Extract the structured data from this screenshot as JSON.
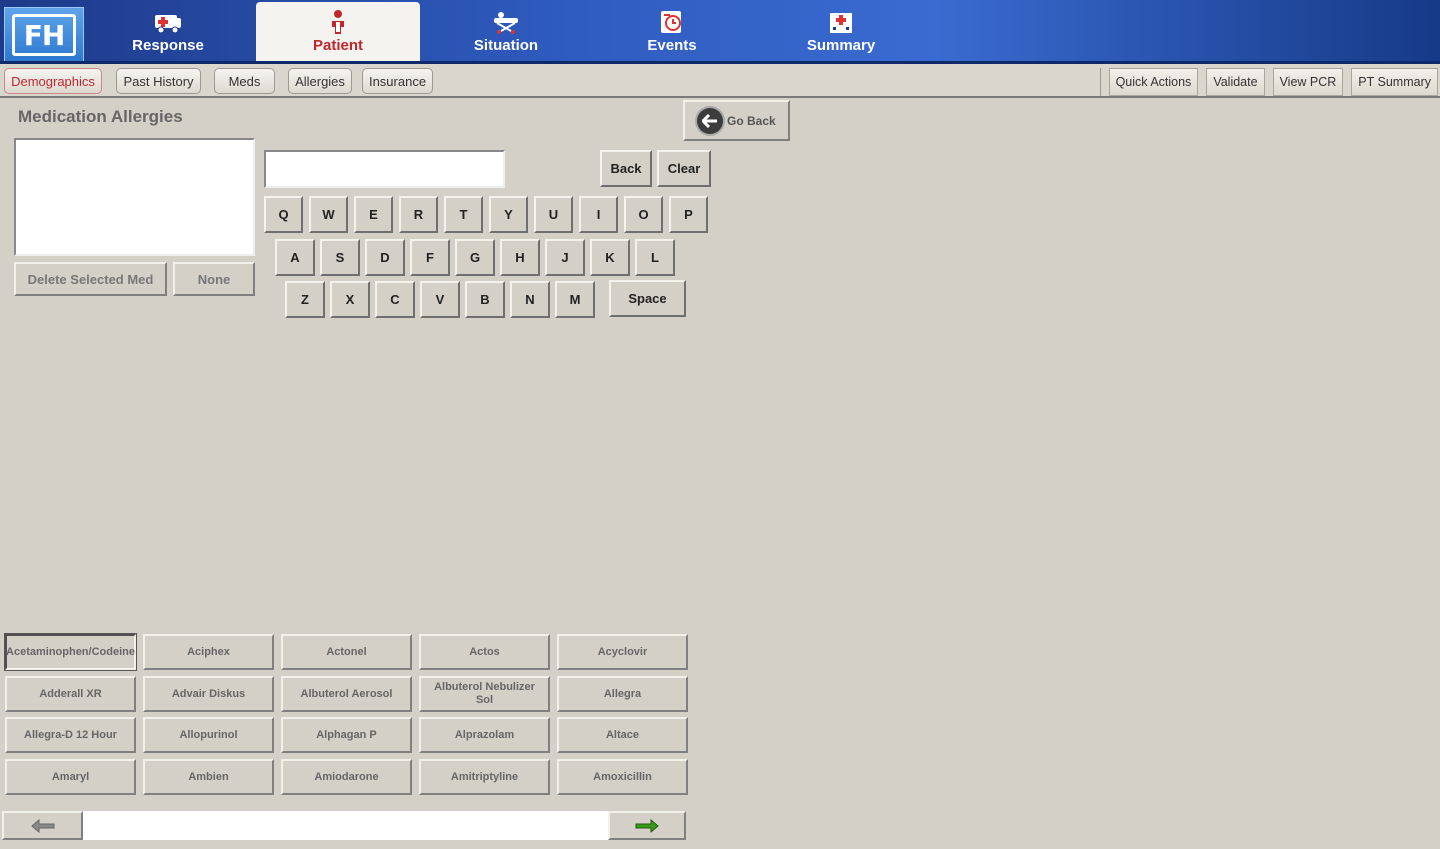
{
  "app": {
    "logo_text": "FH"
  },
  "main_tabs": [
    {
      "label": "Response",
      "icon": "ambulance-icon"
    },
    {
      "label": "Patient",
      "icon": "patient-icon",
      "active": true
    },
    {
      "label": "Situation",
      "icon": "stretcher-icon"
    },
    {
      "label": "Events",
      "icon": "clock-clipboard-icon"
    },
    {
      "label": "Summary",
      "icon": "hospital-icon"
    }
  ],
  "sub_tabs": [
    {
      "label": "Demographics",
      "active": true
    },
    {
      "label": "Past History"
    },
    {
      "label": "Meds"
    },
    {
      "label": "Allergies"
    },
    {
      "label": "Insurance"
    }
  ],
  "actions": [
    "Quick Actions",
    "Validate",
    "View PCR",
    "PT Summary"
  ],
  "section": {
    "title": "Medication Allergies",
    "delete_label": "Delete Selected Med",
    "none_label": "None",
    "go_back_label": "Go Back"
  },
  "search": {
    "value": ""
  },
  "keyboard": {
    "back_label": "Back",
    "clear_label": "Clear",
    "space_label": "Space",
    "row1": [
      "Q",
      "W",
      "E",
      "R",
      "T",
      "Y",
      "U",
      "I",
      "O",
      "P"
    ],
    "row2": [
      "A",
      "S",
      "D",
      "F",
      "G",
      "H",
      "J",
      "K",
      "L"
    ],
    "row3": [
      "Z",
      "X",
      "C",
      "V",
      "B",
      "N",
      "M"
    ]
  },
  "meds": [
    "Acetaminophen/Codeine",
    "Aciphex",
    "Actonel",
    "Actos",
    "Acyclovir",
    "Adderall XR",
    "Advair Diskus",
    "Albuterol Aerosol",
    "Albuterol Nebulizer Sol",
    "Allegra",
    "Allegra-D 12 Hour",
    "Allopurinol",
    "Alphagan P",
    "Alprazolam",
    "Altace",
    "Amaryl",
    "Ambien",
    "Amiodarone",
    "Amitriptyline",
    "Amoxicillin"
  ],
  "colors": {
    "accent": "#c0272d",
    "banner": "#2f5cc0",
    "background": "#d4d0c8"
  }
}
